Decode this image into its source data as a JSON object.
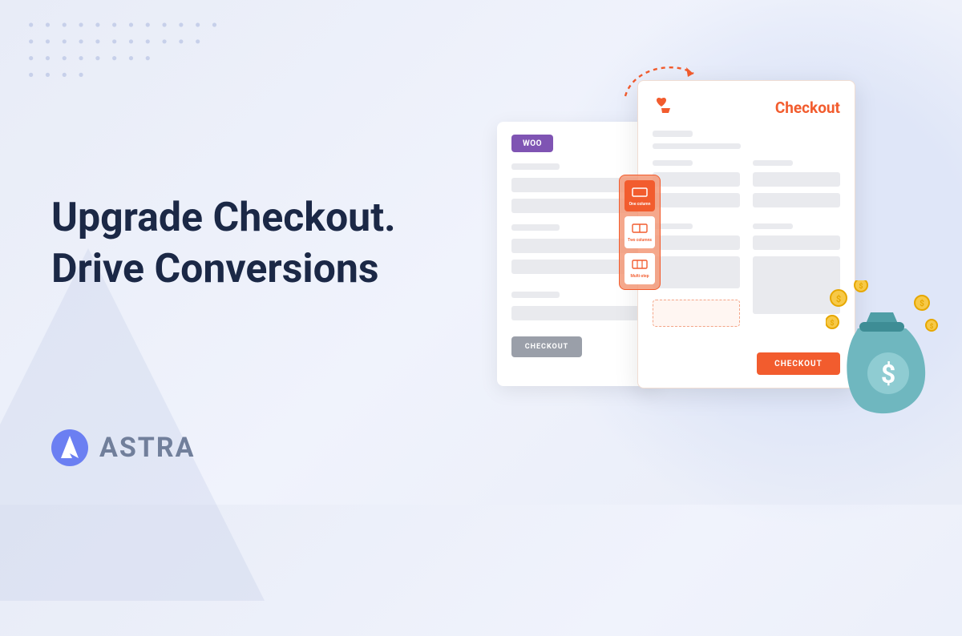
{
  "headline": {
    "line1": "Upgrade Checkout.",
    "line2": "Drive Conversions"
  },
  "logo": {
    "text": "ASTRA"
  },
  "illustration": {
    "back_card": {
      "badge": "WOO",
      "button_label": "CHECKOUT"
    },
    "front_card": {
      "title": "Checkout",
      "button_label": "CHECKOUT"
    },
    "layout_options": [
      {
        "label": "One column"
      },
      {
        "label": "Two columns"
      },
      {
        "label": "Multi-step"
      }
    ]
  },
  "colors": {
    "headline": "#1b2846",
    "accent": "#f25c2e",
    "woo": "#7f54b3",
    "logo": "#6b7ff2",
    "logo_text": "#717f9b"
  }
}
